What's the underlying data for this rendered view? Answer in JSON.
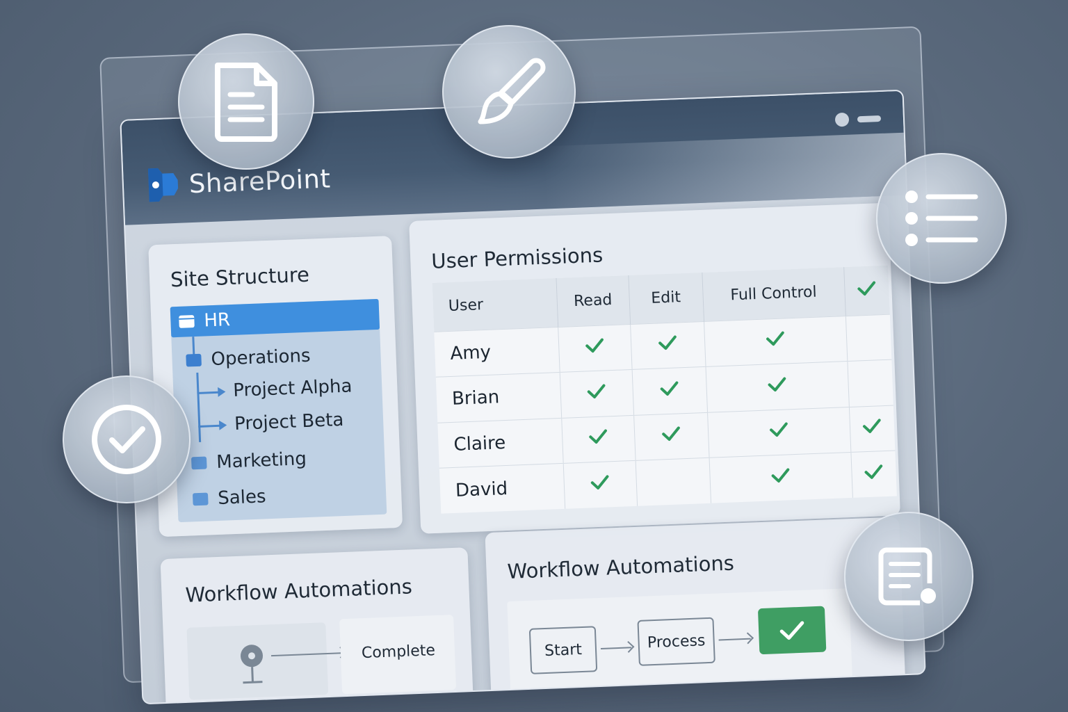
{
  "app": {
    "name": "SharePoint"
  },
  "site_structure": {
    "title": "Site Structure",
    "items": [
      {
        "label": "HR",
        "level": 0,
        "selected": true
      },
      {
        "label": "Operations",
        "level": 0
      },
      {
        "label": "Project Alpha",
        "level": 1
      },
      {
        "label": "Project Beta",
        "level": 1
      },
      {
        "label": "Marketing",
        "level": 0
      },
      {
        "label": "Sales",
        "level": 0
      }
    ]
  },
  "permissions": {
    "title": "User Permissions",
    "columns": [
      "User",
      "Read",
      "Edit",
      "Full Control",
      ""
    ],
    "header_checks": [
      false,
      false,
      false,
      true
    ],
    "rows": [
      {
        "user": "Amy",
        "checks": [
          true,
          true,
          true,
          false
        ]
      },
      {
        "user": "Brian",
        "checks": [
          true,
          true,
          true,
          false
        ]
      },
      {
        "user": "Claire",
        "checks": [
          true,
          true,
          true,
          true
        ]
      },
      {
        "user": "David",
        "checks": [
          true,
          false,
          true,
          true
        ]
      }
    ]
  },
  "workflow_left": {
    "title": "Workflow Automations",
    "end_label": "Complete"
  },
  "workflow_right": {
    "title": "Workflow Automations",
    "steps": [
      "Start",
      "Process"
    ]
  },
  "floating_icons": [
    "document-icon",
    "brush-icon",
    "list-icon",
    "check-circle-icon",
    "certificate-icon"
  ],
  "colors": {
    "accent": "#3f8fde",
    "check": "#2e9a5c",
    "done": "#3f9e63",
    "brand_logo": "#2b7bd6"
  }
}
